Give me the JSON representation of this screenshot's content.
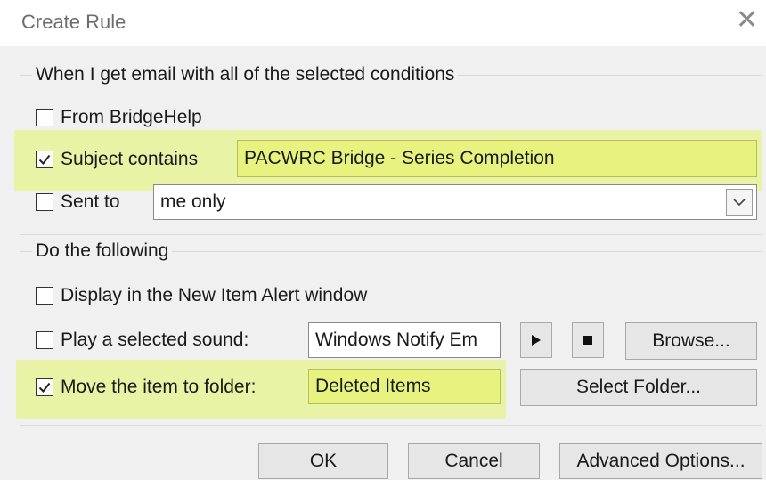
{
  "dialog": {
    "title": "Create Rule"
  },
  "conditions": {
    "legend": "When I get email with all of the selected conditions",
    "from": {
      "label": "From BridgeHelp",
      "checked": false
    },
    "subject": {
      "label": "Subject contains",
      "checked": true,
      "value": "PACWRC Bridge - Series Completion"
    },
    "sent_to": {
      "label": "Sent to",
      "checked": false,
      "value": "me only"
    }
  },
  "actions": {
    "legend": "Do the following",
    "alert": {
      "label": "Display in the New Item Alert window",
      "checked": false
    },
    "sound": {
      "label": "Play a selected sound:",
      "checked": false,
      "value": "Windows Notify Em",
      "browse_label": "Browse..."
    },
    "move": {
      "label": "Move the item to folder:",
      "checked": true,
      "value": "Deleted Items",
      "select_folder_label": "Select Folder..."
    }
  },
  "footer": {
    "ok_label": "OK",
    "cancel_label": "Cancel",
    "advanced_label": "Advanced Options..."
  },
  "colors": {
    "highlight": "#e4f56a"
  }
}
